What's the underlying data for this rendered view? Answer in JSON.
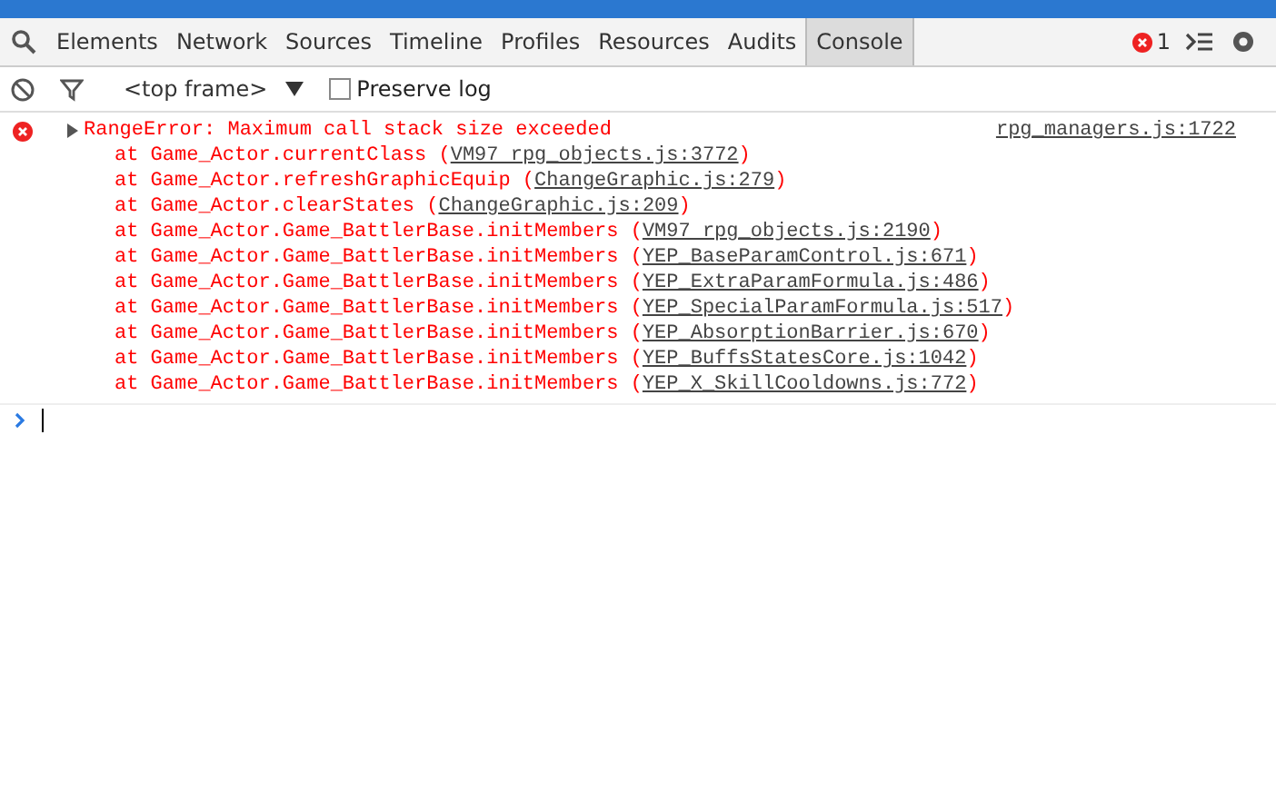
{
  "tabs": [
    {
      "label": "Elements",
      "selected": false
    },
    {
      "label": "Network",
      "selected": false
    },
    {
      "label": "Sources",
      "selected": false
    },
    {
      "label": "Timeline",
      "selected": false
    },
    {
      "label": "Profiles",
      "selected": false
    },
    {
      "label": "Resources",
      "selected": false
    },
    {
      "label": "Audits",
      "selected": false
    },
    {
      "label": "Console",
      "selected": true
    }
  ],
  "error_count": "1",
  "toolbar": {
    "context": "<top frame>",
    "preserve_log": {
      "label": "Preserve log",
      "checked": false
    }
  },
  "messages": [
    {
      "kind": "error",
      "expanded": false,
      "text": "RangeError: Maximum call stack size exceeded",
      "source": "rpg_managers.js:1722",
      "frames": [
        {
          "prefix": "at Game_Actor.currentClass (",
          "source": "VM97 rpg_objects.js:3772",
          "suffix": ")"
        },
        {
          "prefix": "at Game_Actor.refreshGraphicEquip (",
          "source": "ChangeGraphic.js:279",
          "suffix": ")"
        },
        {
          "prefix": "at Game_Actor.clearStates (",
          "source": "ChangeGraphic.js:209",
          "suffix": ")"
        },
        {
          "prefix": "at Game_Actor.Game_BattlerBase.initMembers (",
          "source": "VM97 rpg_objects.js:2190",
          "suffix": ")"
        },
        {
          "prefix": "at Game_Actor.Game_BattlerBase.initMembers (",
          "source": "YEP_BaseParamControl.js:671",
          "suffix": ")"
        },
        {
          "prefix": "at Game_Actor.Game_BattlerBase.initMembers (",
          "source": "YEP_ExtraParamFormula.js:486",
          "suffix": ")"
        },
        {
          "prefix": "at Game_Actor.Game_BattlerBase.initMembers (",
          "source": "YEP_SpecialParamFormula.js:517",
          "suffix": ")"
        },
        {
          "prefix": "at Game_Actor.Game_BattlerBase.initMembers (",
          "source": "YEP_AbsorptionBarrier.js:670",
          "suffix": ")"
        },
        {
          "prefix": "at Game_Actor.Game_BattlerBase.initMembers (",
          "source": "YEP_BuffsStatesCore.js:1042",
          "suffix": ")"
        },
        {
          "prefix": "at Game_Actor.Game_BattlerBase.initMembers (",
          "source": "YEP_X_SkillCooldowns.js:772",
          "suffix": ")"
        }
      ]
    }
  ]
}
